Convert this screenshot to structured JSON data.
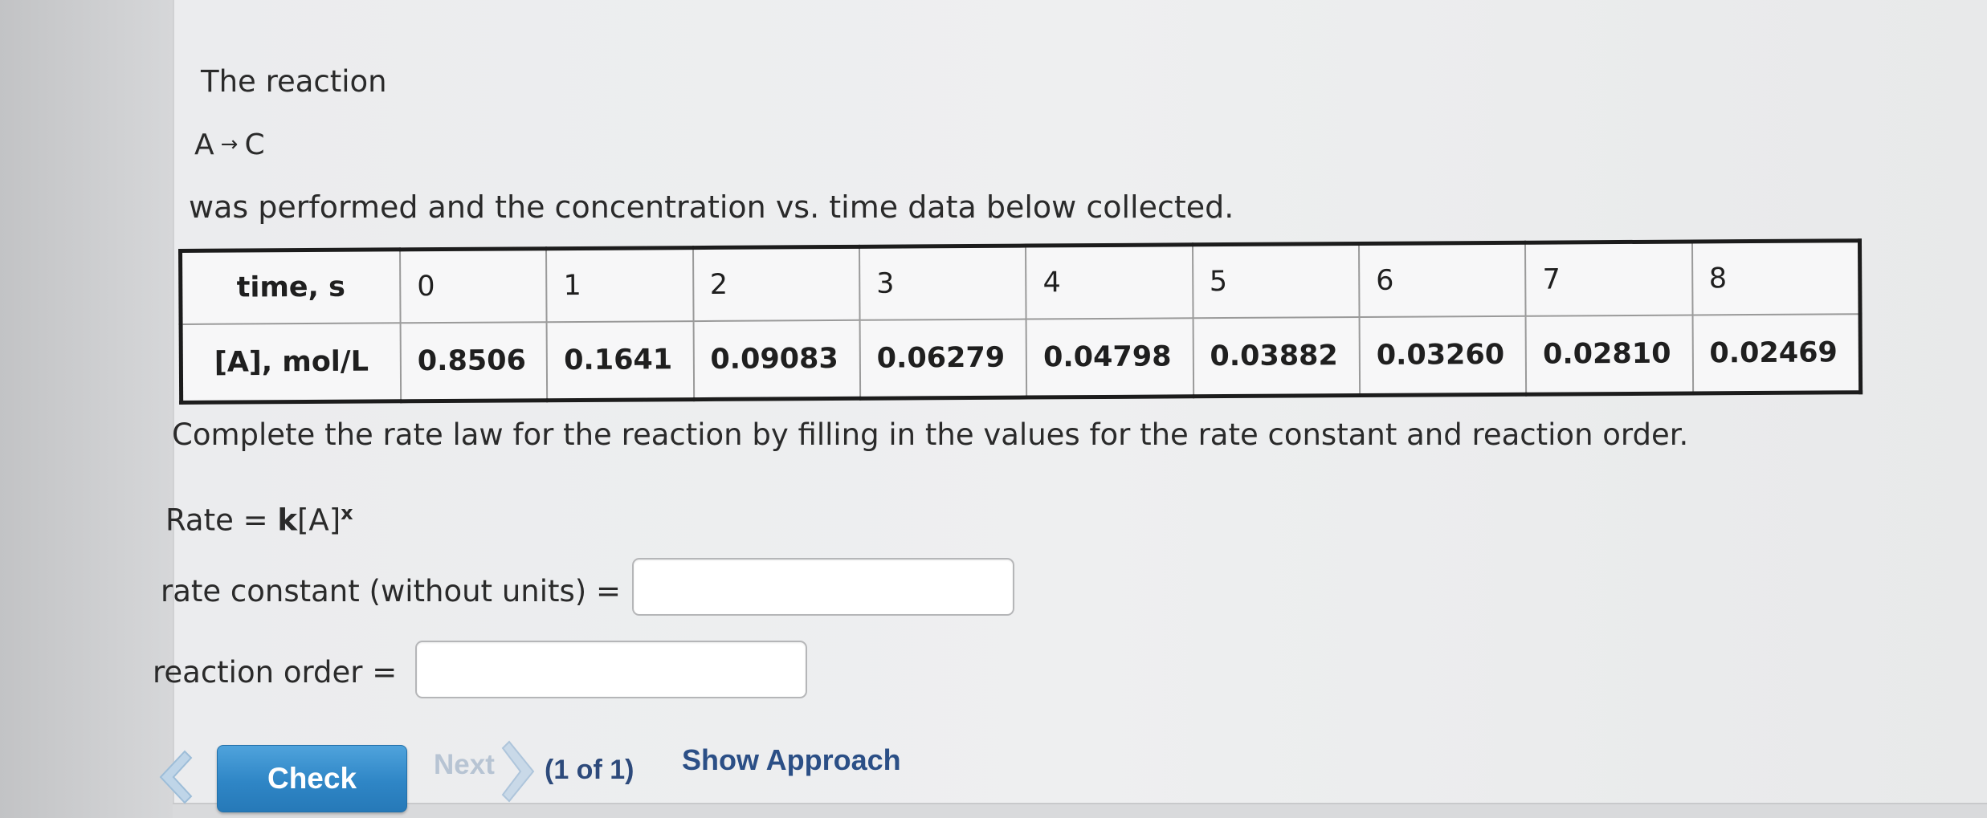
{
  "question": {
    "intro": "The reaction",
    "reaction_reactant": "A",
    "reaction_arrow": "→",
    "reaction_product": "C",
    "description": "was performed and the concentration vs. time data below collected.",
    "prompt": "Complete the rate law for the reaction by filling in the values for the rate constant and reaction order.",
    "rate_law_prefix": "Rate = ",
    "rate_law_k": "k",
    "rate_law_species": "[A]",
    "rate_law_exponent": "x"
  },
  "table": {
    "time_header": "time, s",
    "conc_header": "[A], mol/L",
    "times": [
      "0",
      "1",
      "2",
      "3",
      "4",
      "5",
      "6",
      "7",
      "8"
    ],
    "concentrations": [
      "0.8506",
      "0.1641",
      "0.09083",
      "0.06279",
      "0.04798",
      "0.03882",
      "0.03260",
      "0.02810",
      "0.02469"
    ]
  },
  "answers": {
    "rate_constant_label": "rate constant (without units) =",
    "rate_constant_value": "",
    "reaction_order_label": "reaction order =",
    "reaction_order_value": ""
  },
  "nav": {
    "check_label": "Check",
    "next_label": "Next",
    "count_label": "(1 of 1)",
    "approach_label": "Show Approach",
    "prev_icon": "chevron-left-icon",
    "next_icon": "chevron-right-icon",
    "accent_color": "#2f86c6",
    "disabled_color": "#b7c4d3"
  }
}
